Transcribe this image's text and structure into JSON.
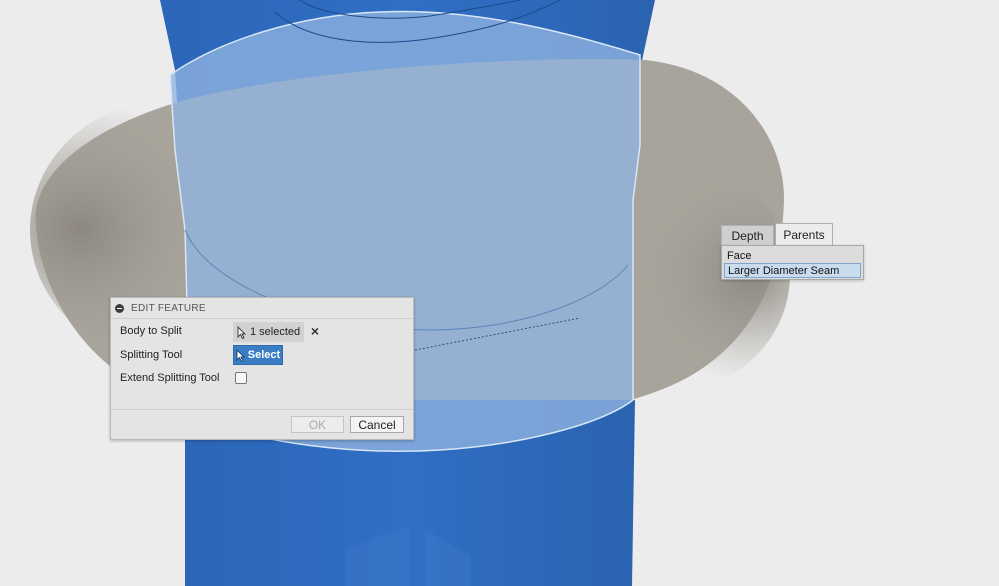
{
  "colors": {
    "background": "#ececec",
    "body_blue": "#2f6ec3",
    "selection_overlay": "#8fb4e0",
    "splitting_surface": "#a8a49b",
    "accent_button": "#3b7dc4"
  },
  "edit_feature": {
    "title": "EDIT FEATURE",
    "body_to_split_label": "Body to Split",
    "body_to_split_value": "1 selected",
    "splitting_tool_label": "Splitting Tool",
    "select_button": "Select",
    "extend_splitting_tool_label": "Extend Splitting Tool",
    "extend_checked": false,
    "ok_label": "OK",
    "cancel_label": "Cancel"
  },
  "selection_popup": {
    "tabs": [
      "Depth",
      "Parents"
    ],
    "active_tab": "Parents",
    "items": [
      "Face",
      "Larger Diameter Seam"
    ],
    "highlighted_item": "Larger Diameter Seam"
  }
}
